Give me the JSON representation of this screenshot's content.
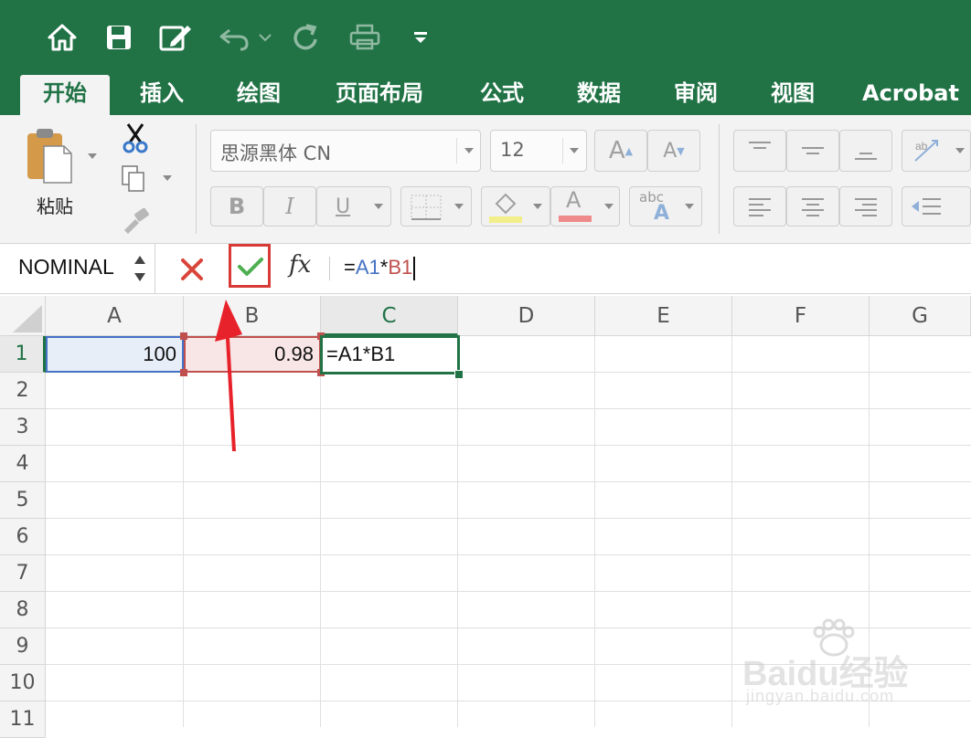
{
  "quick_access": {
    "icons": [
      "home-icon",
      "save-icon",
      "edit-icon",
      "undo-icon",
      "redo-icon",
      "print-icon",
      "customize-icon"
    ]
  },
  "tabs": [
    {
      "label": "开始",
      "active": true
    },
    {
      "label": "插入",
      "active": false
    },
    {
      "label": "绘图",
      "active": false
    },
    {
      "label": "页面布局",
      "active": false
    },
    {
      "label": "公式",
      "active": false
    },
    {
      "label": "数据",
      "active": false
    },
    {
      "label": "审阅",
      "active": false
    },
    {
      "label": "视图",
      "active": false
    },
    {
      "label": "Acrobat",
      "active": false
    }
  ],
  "ribbon": {
    "paste_label": "粘贴",
    "font_name": "思源黑体 CN",
    "font_size": "12",
    "bold": "B",
    "italic": "I",
    "underline": "U",
    "grow_font": "A",
    "shrink_font": "A",
    "font_color": "A",
    "abc": "abc",
    "abc_a": "A"
  },
  "formula_bar": {
    "name_box": "NOMINAL",
    "fx": "fx",
    "formula": {
      "eq": "=",
      "ref1": "A1",
      "op": "*",
      "ref2": "B1"
    }
  },
  "grid": {
    "columns": [
      "A",
      "B",
      "C",
      "D",
      "E",
      "F",
      "G"
    ],
    "rows": [
      "1",
      "2",
      "3",
      "4",
      "5",
      "6",
      "7",
      "8",
      "9",
      "10",
      "11"
    ],
    "cells": {
      "A1": "100",
      "B1": "0.98",
      "C1": "=A1*B1"
    }
  },
  "watermark": {
    "brand": "Baidu经验",
    "url": "jingyan.baidu.com"
  },
  "colors": {
    "excel_green": "#217346",
    "ref_blue": "#4472c4",
    "ref_red": "#c0504d",
    "annotation_red": "#e8222a"
  }
}
